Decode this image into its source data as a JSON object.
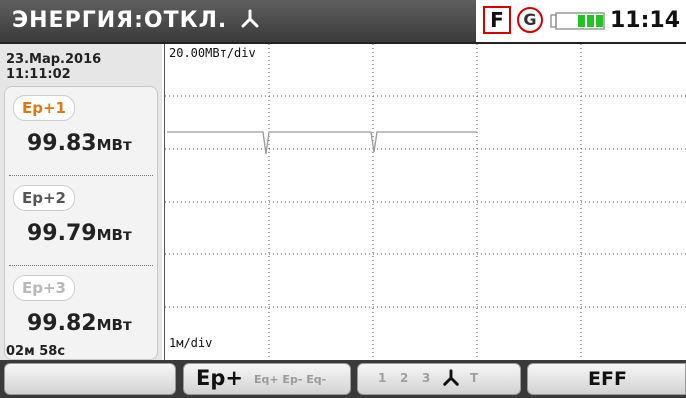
{
  "header": {
    "title": "ЭНЕРГИЯ:ОТКЛ.",
    "title_icon": "three-phase-symbol-icon",
    "flag_f": "F",
    "flag_g": "G",
    "battery_icon": "battery-icon",
    "time": "11:14"
  },
  "sidebar": {
    "date": "23.Мар.2016",
    "time": "11:11:02",
    "items": [
      {
        "label": "Ep+1",
        "value": "99.83",
        "unit": "МВт",
        "state": "active"
      },
      {
        "label": "Ep+2",
        "value": "99.79",
        "unit": "МВт",
        "state": "normal"
      },
      {
        "label": "Ep+3",
        "value": "99.82",
        "unit": "МВт",
        "state": "dim"
      }
    ],
    "duration": "02м 58с"
  },
  "plot": {
    "scale": "20.00МВт/div",
    "time_scale": "1м/div"
  },
  "footer": {
    "btn1_label": "",
    "ep_main": "Ep+",
    "ep_others": "Eq+ Ep- Eq-",
    "phase_1": "1",
    "phase_2": "2",
    "phase_3": "3",
    "phase_icon": "three-phase-symbol-icon",
    "phase_t": "T",
    "eff": "EFF"
  },
  "colors": {
    "header_bg": "#4a4a4a",
    "active_label": "#e07a10",
    "alert_red": "#d40000",
    "battery_green": "#22c322",
    "trace": "#9a9a9a"
  }
}
